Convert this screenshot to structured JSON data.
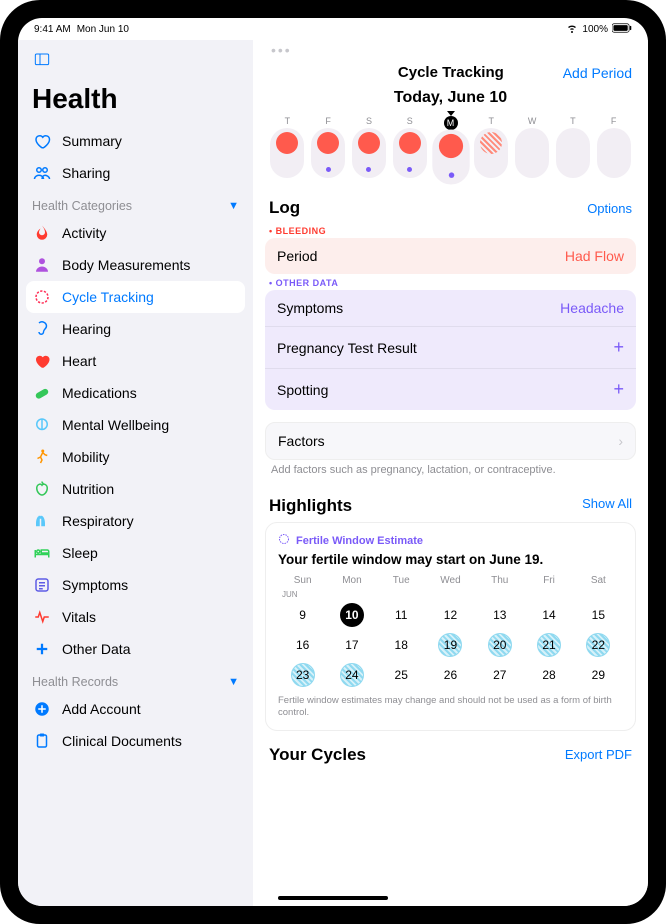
{
  "status": {
    "time": "9:41 AM",
    "date": "Mon Jun 10",
    "battery": "100%",
    "wifi": "wifi"
  },
  "sidebar": {
    "title": "Health",
    "primary": [
      {
        "label": "Summary",
        "icon": "heart-outline"
      },
      {
        "label": "Sharing",
        "icon": "people"
      }
    ],
    "categories_header": "Health Categories",
    "categories": [
      {
        "label": "Activity",
        "icon": "flame",
        "color": "#ff3b30"
      },
      {
        "label": "Body Measurements",
        "icon": "person",
        "color": "#af52de"
      },
      {
        "label": "Cycle Tracking",
        "icon": "cycle",
        "color": "#ff2d55",
        "selected": true
      },
      {
        "label": "Hearing",
        "icon": "ear",
        "color": "#007aff"
      },
      {
        "label": "Heart",
        "icon": "heart",
        "color": "#ff3b30"
      },
      {
        "label": "Medications",
        "icon": "pills",
        "color": "#34c759"
      },
      {
        "label": "Mental Wellbeing",
        "icon": "mind",
        "color": "#5ac8fa"
      },
      {
        "label": "Mobility",
        "icon": "walk",
        "color": "#ff9500"
      },
      {
        "label": "Nutrition",
        "icon": "apple",
        "color": "#34c759"
      },
      {
        "label": "Respiratory",
        "icon": "lungs",
        "color": "#5ac8fa"
      },
      {
        "label": "Sleep",
        "icon": "bed",
        "color": "#30d158"
      },
      {
        "label": "Symptoms",
        "icon": "symptoms",
        "color": "#5e5ce6"
      },
      {
        "label": "Vitals",
        "icon": "vitals",
        "color": "#ff3b30"
      },
      {
        "label": "Other Data",
        "icon": "plus",
        "color": "#007aff"
      }
    ],
    "records_header": "Health Records",
    "records": [
      {
        "label": "Add Account",
        "icon": "plus-circle",
        "color": "#007aff"
      },
      {
        "label": "Clinical Documents",
        "icon": "clipboard",
        "color": "#007aff"
      }
    ]
  },
  "page": {
    "title": "Cycle Tracking",
    "add_period": "Add Period",
    "today_title": "Today, June 10",
    "days": [
      {
        "letter": "T",
        "period": true,
        "symptom": false
      },
      {
        "letter": "F",
        "period": true,
        "symptom": true
      },
      {
        "letter": "S",
        "period": true,
        "symptom": true
      },
      {
        "letter": "S",
        "period": true,
        "symptom": true
      },
      {
        "letter": "M",
        "period": true,
        "symptom": true,
        "today": true
      },
      {
        "letter": "T",
        "hatched": true
      },
      {
        "letter": "W"
      },
      {
        "letter": "T"
      },
      {
        "letter": "F"
      }
    ]
  },
  "log": {
    "title": "Log",
    "options": "Options",
    "bleeding_label": "BLEEDING",
    "period_row": {
      "label": "Period",
      "value": "Had Flow"
    },
    "other_label": "OTHER DATA",
    "symptoms_row": {
      "label": "Symptoms",
      "value": "Headache"
    },
    "pregnancy_row": {
      "label": "Pregnancy Test Result"
    },
    "spotting_row": {
      "label": "Spotting"
    },
    "factors_row": {
      "label": "Factors"
    },
    "factors_hint": "Add factors such as pregnancy, lactation, or contraceptive."
  },
  "highlights": {
    "title": "Highlights",
    "show_all": "Show All",
    "fertile_tag": "Fertile Window Estimate",
    "fertile_msg": "Your fertile window may start on June 19.",
    "weekdays": [
      "Sun",
      "Mon",
      "Tue",
      "Wed",
      "Thu",
      "Fri",
      "Sat"
    ],
    "month": "JUN",
    "rows": [
      [
        {
          "d": 9
        },
        {
          "d": 10,
          "today": true
        },
        {
          "d": 11
        },
        {
          "d": 12
        },
        {
          "d": 13
        },
        {
          "d": 14
        },
        {
          "d": 15
        }
      ],
      [
        {
          "d": 16
        },
        {
          "d": 17
        },
        {
          "d": 18
        },
        {
          "d": 19,
          "f": true
        },
        {
          "d": 20,
          "f": true
        },
        {
          "d": 21,
          "f": true
        },
        {
          "d": 22,
          "f": true
        }
      ],
      [
        {
          "d": 23,
          "f": true
        },
        {
          "d": 24,
          "f": true
        },
        {
          "d": 25
        },
        {
          "d": 26
        },
        {
          "d": 27
        },
        {
          "d": 28
        },
        {
          "d": 29
        }
      ]
    ],
    "note": "Fertile window estimates may change and should not be used as a form of birth control."
  },
  "bottom": {
    "your_cycles": "Your Cycles",
    "export": "Export PDF"
  }
}
